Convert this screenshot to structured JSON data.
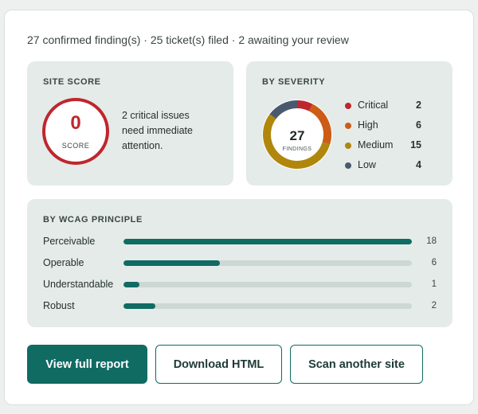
{
  "summary": "27 confirmed finding(s) · 25 ticket(s) filed · 2 awaiting your review",
  "site_score": {
    "title": "SITE SCORE",
    "score": "0",
    "score_label": "SCORE",
    "message": "2 critical issues need immediate attention.",
    "ring_color": "#c0262d"
  },
  "severity": {
    "title": "BY SEVERITY",
    "total": "27",
    "total_label": "FINDINGS",
    "items": [
      {
        "label": "Critical",
        "count": "2",
        "value": 2,
        "color": "#c0262d"
      },
      {
        "label": "High",
        "count": "6",
        "value": 6,
        "color": "#cc5c16"
      },
      {
        "label": "Medium",
        "count": "15",
        "value": 15,
        "color": "#b0870c"
      },
      {
        "label": "Low",
        "count": "4",
        "value": 4,
        "color": "#4a5a6e"
      }
    ]
  },
  "wcag": {
    "title": "BY WCAG PRINCIPLE",
    "max": 18,
    "rows": [
      {
        "label": "Perceivable",
        "count": "18",
        "value": 18
      },
      {
        "label": "Operable",
        "count": "6",
        "value": 6
      },
      {
        "label": "Understandable",
        "count": "1",
        "value": 1
      },
      {
        "label": "Robust",
        "count": "2",
        "value": 2
      }
    ]
  },
  "buttons": {
    "view_report": "View full report",
    "download_html": "Download HTML",
    "scan_another": "Scan another site"
  },
  "colors": {
    "accent": "#106b63",
    "track": "#cdd8d4"
  }
}
